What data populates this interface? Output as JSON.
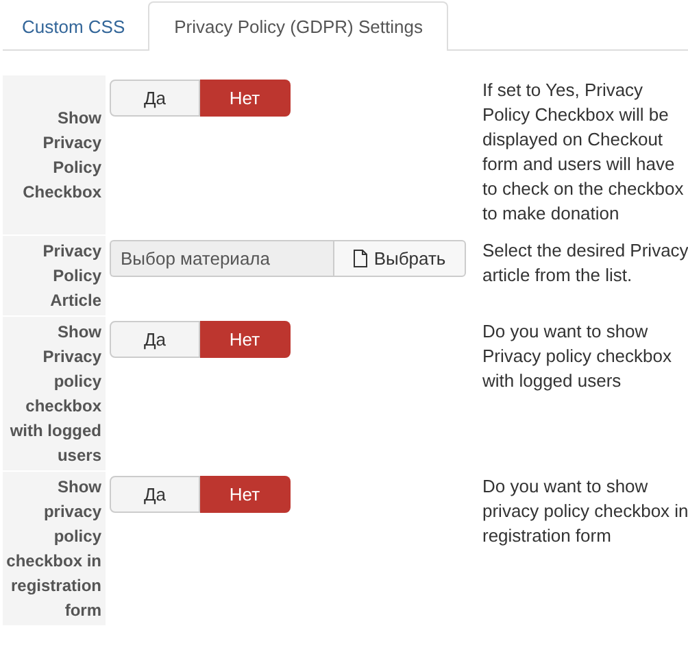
{
  "tabs": [
    {
      "label": "Custom CSS",
      "selected": false
    },
    {
      "label": "Privacy Policy (GDPR) Settings",
      "selected": true
    }
  ],
  "fields": [
    {
      "kind": "toggle",
      "label": "Show Privacy Policy Checkbox",
      "options": [
        {
          "label": "Да",
          "selected": false
        },
        {
          "label": "Нет",
          "selected": true
        }
      ],
      "description": "If set to Yes, Privacy Policy Checkbox will be displayed on Checkout form and users will have to check on the checkbox to make donation"
    },
    {
      "kind": "picker",
      "label": "Privacy Policy Article",
      "value": "Выбор материала",
      "button": "Выбрать",
      "description": "Select the desired Privacy article from the list."
    },
    {
      "kind": "toggle",
      "label": "Show Privacy policy checkbox with logged users",
      "options": [
        {
          "label": "Да",
          "selected": false
        },
        {
          "label": "Нет",
          "selected": true
        }
      ],
      "description": "Do you want to show Privacy policy checkbox with logged users"
    },
    {
      "kind": "toggle",
      "label": "Show privacy policy checkbox in registration form",
      "options": [
        {
          "label": "Да",
          "selected": false
        },
        {
          "label": "Нет",
          "selected": true
        }
      ],
      "description": "Do you want to show privacy policy checkbox in registration form"
    }
  ]
}
